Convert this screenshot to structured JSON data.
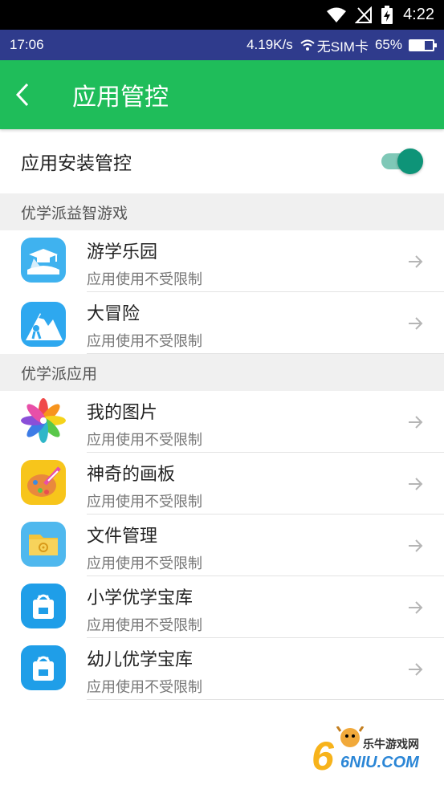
{
  "system_status": {
    "time": "4:22"
  },
  "device_status": {
    "time": "17:06",
    "speed": "4.19K/s",
    "sim": "无SIM卡",
    "battery": "65%",
    "battery_level": 0.65
  },
  "app_bar": {
    "title": "应用管控"
  },
  "install_control": {
    "label": "应用安装管控",
    "enabled": true
  },
  "sections": [
    {
      "header": "优学派益智游戏",
      "apps": [
        {
          "name": "游学乐园",
          "status": "应用使用不受限制",
          "icon": "school-hat-icon"
        },
        {
          "name": "大冒险",
          "status": "应用使用不受限制",
          "icon": "mountain-climber-icon"
        }
      ]
    },
    {
      "header": "优学派应用",
      "apps": [
        {
          "name": "我的图片",
          "status": "应用使用不受限制",
          "icon": "photo-flower-icon"
        },
        {
          "name": "神奇的画板",
          "status": "应用使用不受限制",
          "icon": "palette-icon"
        },
        {
          "name": "文件管理",
          "status": "应用使用不受限制",
          "icon": "folder-icon"
        },
        {
          "name": "小学优学宝库",
          "status": "应用使用不受限制",
          "icon": "store-bag-icon"
        },
        {
          "name": "幼儿优学宝库",
          "status": "应用使用不受限制",
          "icon": "store-bag-icon"
        }
      ]
    }
  ],
  "watermark": {
    "text": "乐牛游戏网",
    "brand": "6NIU.COM"
  },
  "colors": {
    "app_bar": "#1fbd5a",
    "device_bar": "#2f3b8c",
    "toggle_on": "#0e9478"
  }
}
